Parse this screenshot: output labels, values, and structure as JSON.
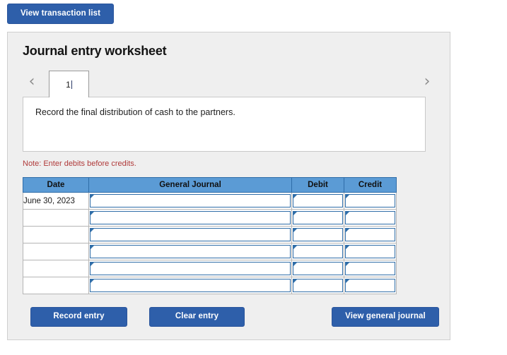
{
  "top_bar": {
    "view_transaction_list_label": "View transaction list"
  },
  "worksheet": {
    "title": "Journal entry worksheet",
    "tabs": {
      "prev_icon": "chevron-left-icon",
      "next_icon": "chevron-right-icon",
      "items": [
        {
          "label": "1",
          "active": true
        }
      ]
    },
    "instruction": "Record the final distribution of cash to the partners.",
    "note": "Note: Enter debits before credits.",
    "table": {
      "columns": [
        "Date",
        "General Journal",
        "Debit",
        "Credit"
      ],
      "rows": [
        {
          "date": "June 30, 2023",
          "general_journal": "",
          "debit": "",
          "credit": ""
        },
        {
          "date": "",
          "general_journal": "",
          "debit": "",
          "credit": ""
        },
        {
          "date": "",
          "general_journal": "",
          "debit": "",
          "credit": ""
        },
        {
          "date": "",
          "general_journal": "",
          "debit": "",
          "credit": ""
        },
        {
          "date": "",
          "general_journal": "",
          "debit": "",
          "credit": ""
        },
        {
          "date": "",
          "general_journal": "",
          "debit": "",
          "credit": ""
        }
      ]
    },
    "actions": {
      "record_entry_label": "Record entry",
      "clear_entry_label": "Clear entry",
      "view_general_journal_label": "View general journal"
    }
  },
  "colors": {
    "button_blue": "#2e5faa",
    "table_header_blue": "#5b9bd5",
    "input_border_blue": "#2f6da8",
    "note_red": "#b03a3a",
    "panel_background": "#efefef"
  }
}
